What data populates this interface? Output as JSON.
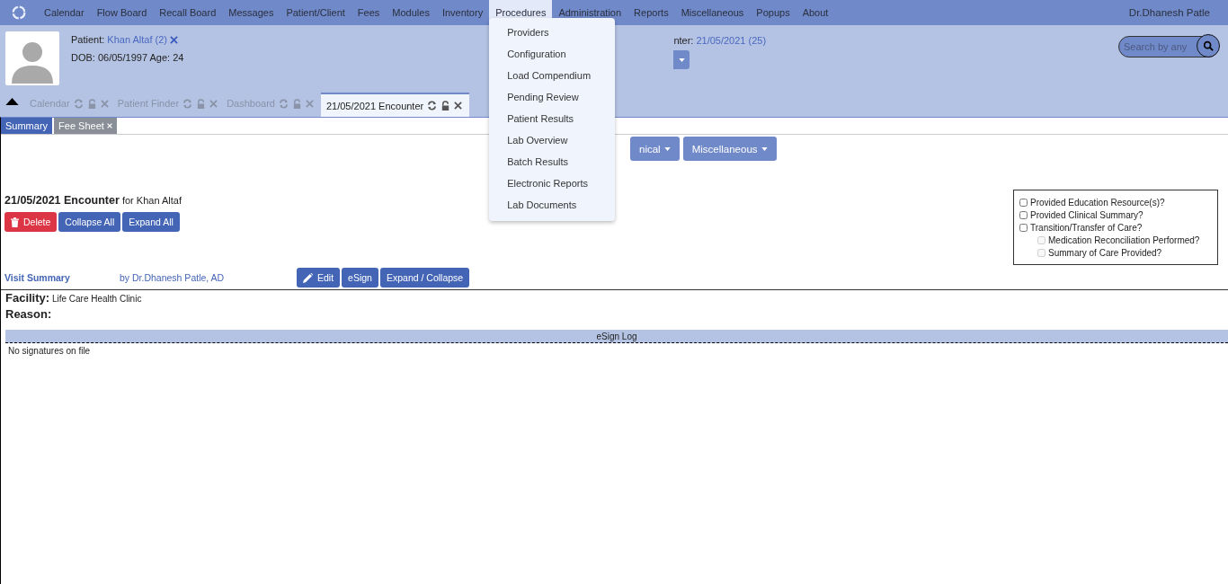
{
  "nav": {
    "items": [
      {
        "label": "Calendar",
        "selected": false
      },
      {
        "label": "Flow Board",
        "selected": false
      },
      {
        "label": "Recall Board",
        "selected": false
      },
      {
        "label": "Messages",
        "selected": false
      },
      {
        "label": "Patient/Client",
        "selected": false
      },
      {
        "label": "Fees",
        "selected": false
      },
      {
        "label": "Modules",
        "selected": false
      },
      {
        "label": "Inventory",
        "selected": false
      },
      {
        "label": "Procedures",
        "selected": true
      },
      {
        "label": "Administration",
        "selected": false
      },
      {
        "label": "Reports",
        "selected": false
      },
      {
        "label": "Miscellaneous",
        "selected": false
      },
      {
        "label": "Popups",
        "selected": false
      },
      {
        "label": "About",
        "selected": false
      }
    ],
    "user": "Dr.Dhanesh Patle"
  },
  "patient": {
    "label": "Patient:",
    "name": "Khan Altaf (2)",
    "dob": "DOB: 06/05/1997 Age: 24"
  },
  "encounter_info": {
    "label": "nter:",
    "value": "21/05/2021 (25)"
  },
  "search": {
    "placeholder": "Search by any"
  },
  "open_tabs": [
    {
      "label": "Calendar",
      "selected": false
    },
    {
      "label": "Patient Finder",
      "selected": false
    },
    {
      "label": "Dashboard",
      "selected": false
    },
    {
      "label": "21/05/2021 Encounter",
      "selected": true
    }
  ],
  "procedures_menu": [
    "Providers",
    "Configuration",
    "Load Compendium",
    "Pending Review",
    "Patient Results",
    "Lab Overview",
    "Batch Results",
    "Electronic Reports",
    "Lab Documents"
  ],
  "sub_tabs": [
    {
      "label": "Summary",
      "selected": true
    },
    {
      "label": "Fee Sheet",
      "selected": false
    }
  ],
  "toolbar": [
    "nical",
    "Miscellaneous"
  ],
  "encounter": {
    "title": "21/05/2021 Encounter",
    "for": "for Khan Altaf",
    "buttons": [
      {
        "label": "Delete",
        "kind": "danger"
      },
      {
        "label": "Collapse All",
        "kind": "primary"
      },
      {
        "label": "Expand All",
        "kind": "primary"
      }
    ]
  },
  "care_checks": [
    {
      "label": "Provided Education Resource(s)?",
      "checked": false,
      "disabled": false
    },
    {
      "label": "Provided Clinical Summary?",
      "checked": false,
      "disabled": false
    },
    {
      "label": "Transition/Transfer of Care?",
      "checked": false,
      "disabled": false,
      "children": [
        {
          "label": "Medication Reconciliation Performed?",
          "checked": false,
          "disabled": true
        },
        {
          "label": "Summary of Care Provided?",
          "checked": false,
          "disabled": true
        }
      ]
    }
  ],
  "visit_summary": {
    "title": "Visit Summary",
    "by": "by Dr.Dhanesh Patle, AD",
    "buttons": [
      {
        "label": "Edit",
        "kind": "edit"
      },
      {
        "label": "eSign",
        "kind": "plain"
      },
      {
        "label": "Expand / Collapse",
        "kind": "plain"
      }
    ]
  },
  "facility": {
    "label": "Facility:",
    "value": "Life Care Health Clinic"
  },
  "reason": {
    "label": "Reason:"
  },
  "esign_log": {
    "title": "eSign Log",
    "message": "No signatures on file"
  }
}
